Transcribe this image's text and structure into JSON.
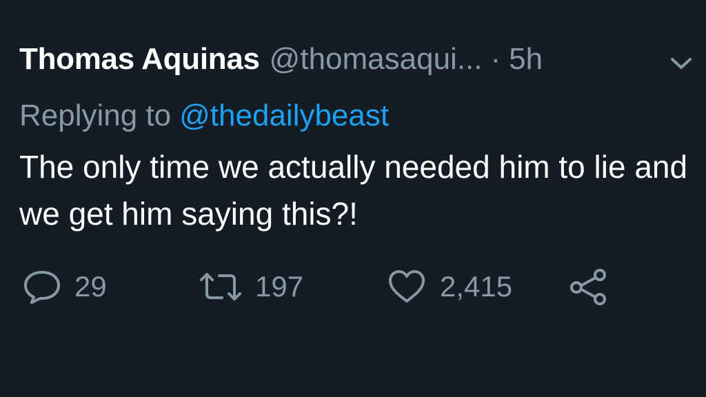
{
  "tweet": {
    "display_name": "Thomas Aquinas",
    "handle": "@thomasaqui...",
    "separator": "·",
    "time": "5h",
    "replying_prefix": "Replying to",
    "replying_to": "@thedailybeast",
    "text": "The only time we actually needed him to lie and we get him saying this?!"
  },
  "actions": {
    "replies": "29",
    "retweets": "197",
    "likes": "2,415"
  },
  "icons": {
    "menu": "chevron-down-icon",
    "reply": "reply-bubble-icon",
    "retweet": "retweet-icon",
    "like": "heart-icon",
    "share": "share-icon"
  },
  "colors": {
    "background": "#151c26",
    "primary_text": "#ffffff",
    "secondary_text": "#8899a6",
    "link": "#1da1f2"
  }
}
